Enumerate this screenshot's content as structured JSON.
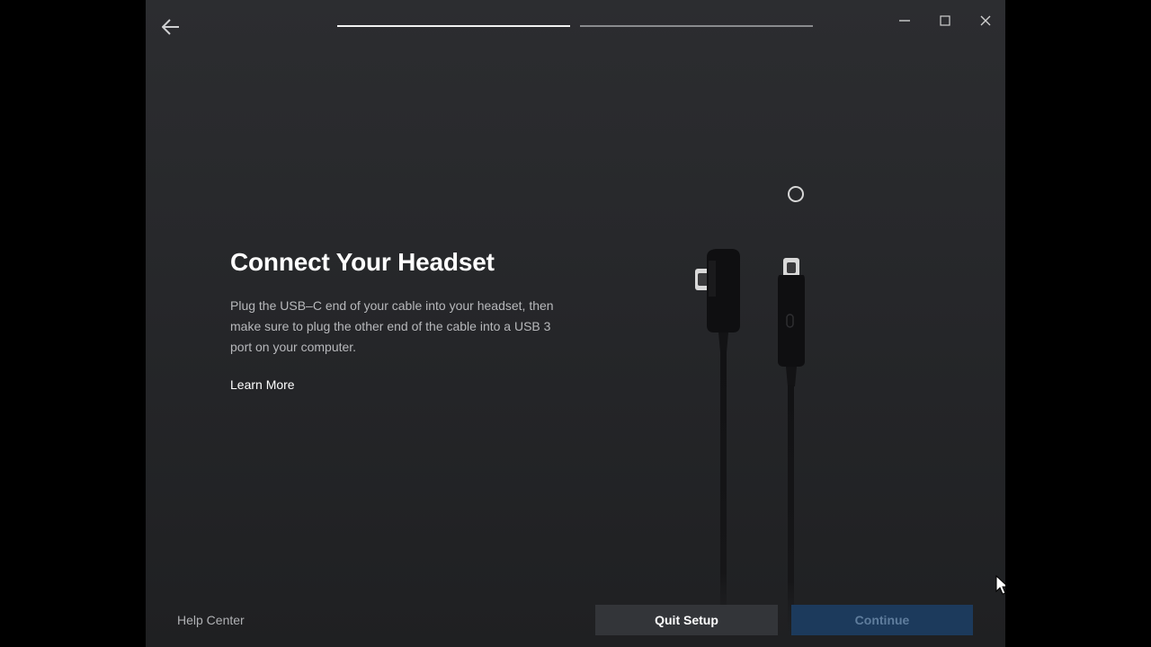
{
  "header": {
    "back_icon": "arrow-left-icon",
    "progress_steps": [
      {
        "state": "active"
      },
      {
        "state": "inactive"
      }
    ],
    "window_controls": [
      "minimize-icon",
      "maximize-icon",
      "close-icon"
    ]
  },
  "main": {
    "title": "Connect Your Headset",
    "description": "Plug the USB–C end of your cable into your headset, then make sure to plug the other end of the cable into a USB 3 port on your computer.",
    "learn_more": "Learn More",
    "illustration": "usb-c-cable-icon",
    "loading_indicator": "loading-ring-icon"
  },
  "footer": {
    "help_center": "Help Center",
    "quit_setup": "Quit Setup",
    "continue": "Continue"
  },
  "colors": {
    "window_bg": "#2a2b2e",
    "primary_disabled": "#1c3a5c",
    "secondary_button": "#333539",
    "text_primary": "#ffffff",
    "text_secondary": "#b7b8bb"
  }
}
